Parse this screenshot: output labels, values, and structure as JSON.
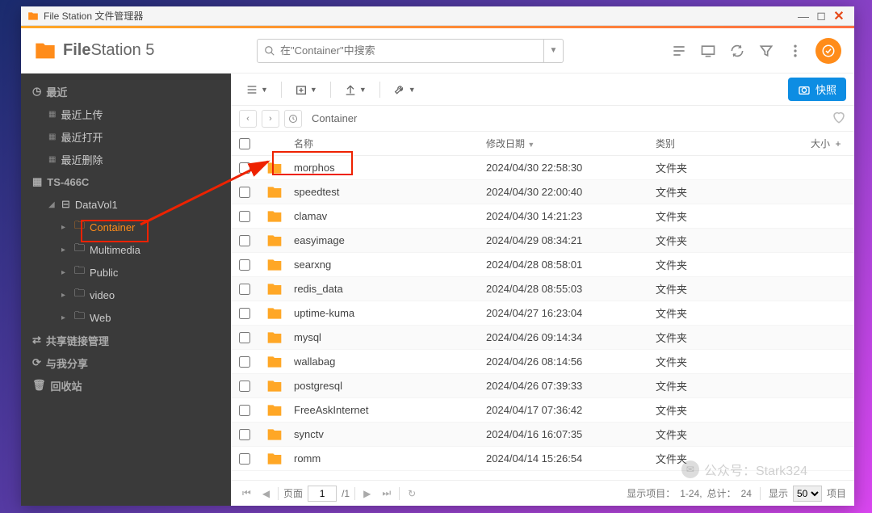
{
  "window": {
    "title": "File Station 文件管理器"
  },
  "app": {
    "name_bold": "File",
    "name_rest": "Station 5"
  },
  "search": {
    "placeholder": "在\"Container\"中搜索"
  },
  "snapshot_label": "快照",
  "sidebar": {
    "recent": {
      "label": "最近",
      "upload": "最近上传",
      "open": "最近打开",
      "delete": "最近删除"
    },
    "device": "TS-466C",
    "vol": "DataVol1",
    "folders": [
      "Container",
      "Multimedia",
      "Public",
      "video",
      "Web"
    ],
    "share_links": "共享链接管理",
    "shared_with_me": "与我分享",
    "recycle": "回收站"
  },
  "breadcrumb": {
    "current": "Container"
  },
  "columns": {
    "name": "名称",
    "date": "修改日期",
    "type": "类别",
    "size": "大小"
  },
  "rows": [
    {
      "name": "morphos",
      "date": "2024/04/30 22:58:30",
      "type": "文件夹"
    },
    {
      "name": "speedtest",
      "date": "2024/04/30 22:00:40",
      "type": "文件夹"
    },
    {
      "name": "clamav",
      "date": "2024/04/30 14:21:23",
      "type": "文件夹"
    },
    {
      "name": "easyimage",
      "date": "2024/04/29 08:34:21",
      "type": "文件夹"
    },
    {
      "name": "searxng",
      "date": "2024/04/28 08:58:01",
      "type": "文件夹"
    },
    {
      "name": "redis_data",
      "date": "2024/04/28 08:55:03",
      "type": "文件夹"
    },
    {
      "name": "uptime-kuma",
      "date": "2024/04/27 16:23:04",
      "type": "文件夹"
    },
    {
      "name": "mysql",
      "date": "2024/04/26 09:14:34",
      "type": "文件夹"
    },
    {
      "name": "wallabag",
      "date": "2024/04/26 08:14:56",
      "type": "文件夹"
    },
    {
      "name": "postgresql",
      "date": "2024/04/26 07:39:33",
      "type": "文件夹"
    },
    {
      "name": "FreeAskInternet",
      "date": "2024/04/17 07:36:42",
      "type": "文件夹"
    },
    {
      "name": "synctv",
      "date": "2024/04/16 16:07:35",
      "type": "文件夹"
    },
    {
      "name": "romm",
      "date": "2024/04/14 15:26:54",
      "type": "文件夹"
    }
  ],
  "pager": {
    "page_label": "页面",
    "page": "1",
    "total_pages": "/1",
    "summary_prefix": "显示项目：",
    "summary_range": "1-24,",
    "summary_total_label": "总计：",
    "summary_total": "24",
    "perpage_label": "显示",
    "perpage": "50",
    "item_label": "项目"
  },
  "watermark": "公众号：Stark324"
}
